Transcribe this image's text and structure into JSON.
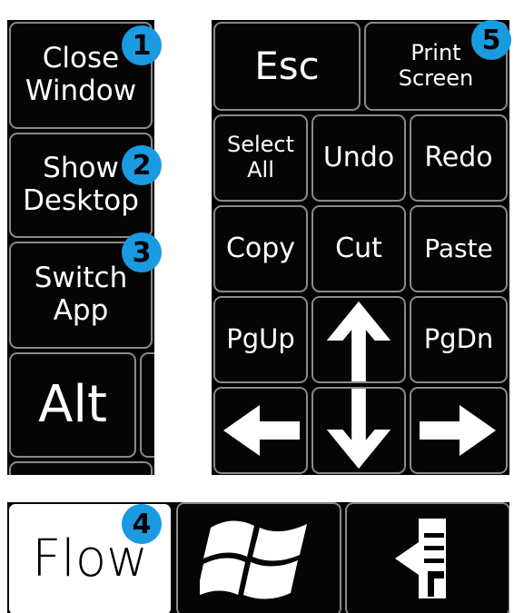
{
  "left_panel": {
    "close_window": "Close\nWindow",
    "show_desktop": "Show\nDesktop",
    "switch_app": "Switch\nApp",
    "alt": "Alt"
  },
  "right_panel": {
    "esc": "Esc",
    "print_screen": "Print\nScreen",
    "select_all": "Select\nAll",
    "undo": "Undo",
    "redo": "Redo",
    "copy": "Copy",
    "cut": "Cut",
    "paste": "Paste",
    "pgup": "PgUp",
    "pgdn": "PgDn",
    "up_icon": "arrow-up-icon",
    "down_icon": "arrow-down-icon",
    "left_icon": "arrow-left-icon",
    "right_icon": "arrow-right-icon"
  },
  "bottom_bar": {
    "flow": "Flow",
    "windows_icon": "windows-logo-icon",
    "keyboard_icon": "keyboard-collapse-icon"
  },
  "badges": [
    "1",
    "2",
    "3",
    "4",
    "5"
  ],
  "colors": {
    "badge": "#1a9ae0",
    "key_bg": "#050505",
    "key_border": "#8a8a8a"
  }
}
